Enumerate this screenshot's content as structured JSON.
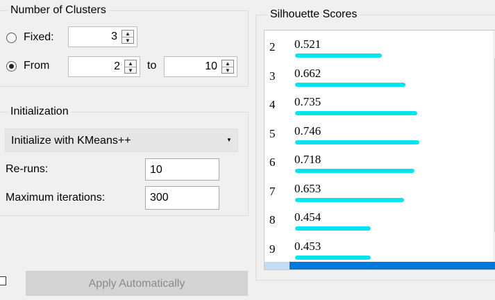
{
  "clusters": {
    "title": "Number of Clusters",
    "fixed": {
      "label": "Fixed:",
      "value": "3",
      "selected": false
    },
    "range": {
      "label": "From",
      "from": "2",
      "to_label": "to",
      "to": "10",
      "selected": true
    }
  },
  "init": {
    "title": "Initialization",
    "method": "Initialize with KMeans++",
    "reruns_label": "Re-runs:",
    "reruns_value": "10",
    "maxiter_label": "Maximum iterations:",
    "maxiter_value": "300"
  },
  "silhouette": {
    "title": "Silhouette Scores",
    "rows": [
      {
        "k": "2",
        "score": "0.521",
        "fraction": 0.521
      },
      {
        "k": "3",
        "score": "0.662",
        "fraction": 0.662
      },
      {
        "k": "4",
        "score": "0.735",
        "fraction": 0.735
      },
      {
        "k": "5",
        "score": "0.746",
        "fraction": 0.746
      },
      {
        "k": "6",
        "score": "0.718",
        "fraction": 0.718
      },
      {
        "k": "7",
        "score": "0.653",
        "fraction": 0.653
      },
      {
        "k": "8",
        "score": "0.454",
        "fraction": 0.454
      },
      {
        "k": "9",
        "score": "0.453",
        "fraction": 0.453
      }
    ]
  },
  "apply": {
    "label": "Apply Automatically",
    "checked": false
  },
  "colors": {
    "bar": "#00e5ee",
    "selection": "#0078d7"
  },
  "icons": {
    "spin": "spin-up-down-icon",
    "dropdown": "dropdown-arrow-icon"
  }
}
